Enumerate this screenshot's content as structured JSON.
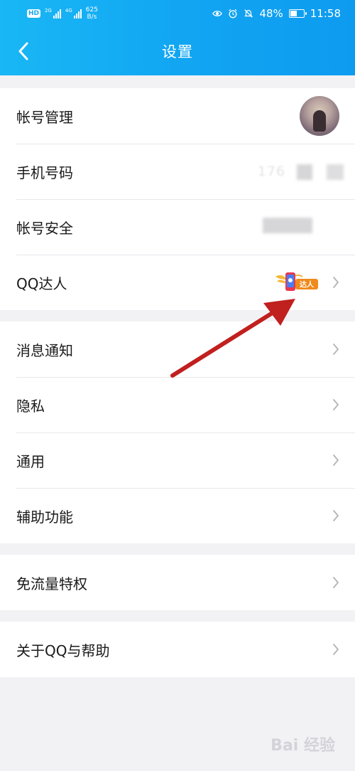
{
  "status_bar": {
    "network_badge": "HD",
    "signal1_type": "2G",
    "signal2_type": "4G",
    "speed_value": "625",
    "speed_unit": "B/s",
    "battery": "48%",
    "time": "11:58",
    "icons": [
      "eye-icon",
      "alarm-icon",
      "mute-icon",
      "battery-icon"
    ]
  },
  "header": {
    "back_icon": "back-chevron-icon",
    "title": "设置"
  },
  "groups": [
    {
      "items": [
        {
          "label": "帐号管理",
          "trailing": "avatar"
        },
        {
          "label": "手机号码",
          "trailing": "masked-phone",
          "value": "176"
        },
        {
          "label": "帐号安全",
          "trailing": "masked-status"
        },
        {
          "label": "QQ达人",
          "trailing": "badge",
          "badge_text": "达人"
        }
      ]
    },
    {
      "items": [
        {
          "label": "消息通知"
        },
        {
          "label": "隐私"
        },
        {
          "label": "通用"
        },
        {
          "label": "辅助功能"
        }
      ]
    },
    {
      "items": [
        {
          "label": "免流量特权"
        }
      ]
    },
    {
      "items": [
        {
          "label": "关于QQ与帮助"
        }
      ]
    }
  ],
  "watermark": "Bai 经验",
  "colors": {
    "header_gradient_start": "#19b7f5",
    "header_gradient_end": "#0d9bf0",
    "background": "#f2f2f5",
    "annotation_arrow": "#c0201e",
    "badge_orange": "#f08a1c"
  }
}
